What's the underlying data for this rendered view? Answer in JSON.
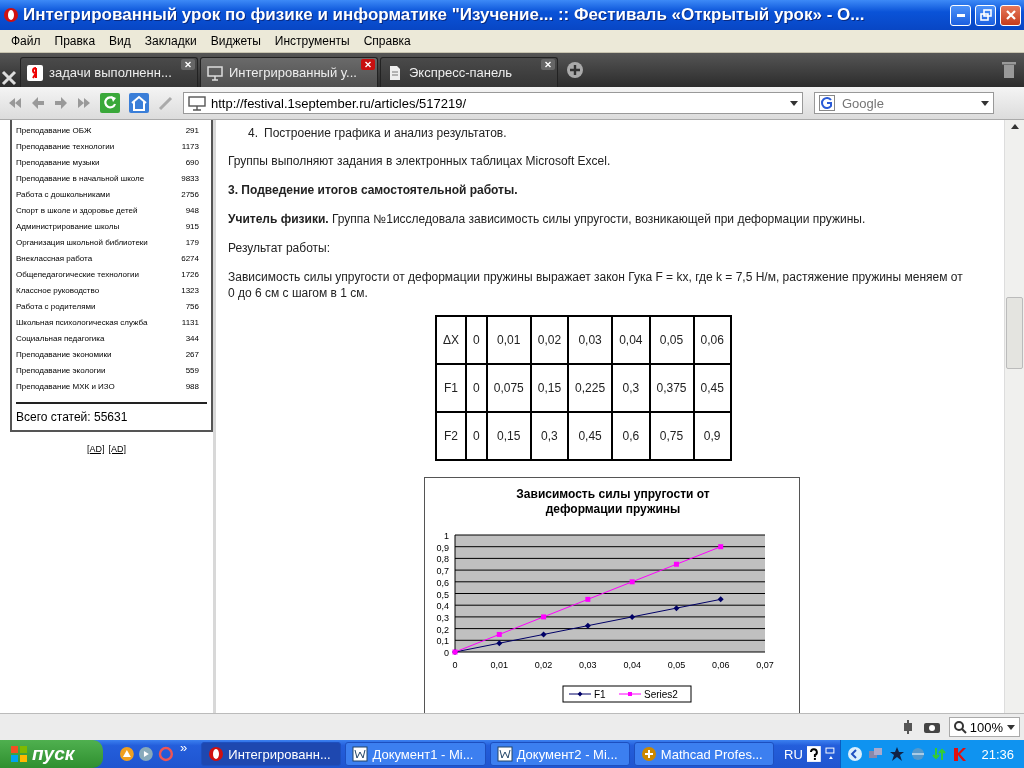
{
  "window": {
    "title": "Интегрированный урок по физике и информатике \"Изучение... :: Фестиваль «Открытый урок» - О..."
  },
  "menu": [
    "Файл",
    "Правка",
    "Вид",
    "Закладки",
    "Виджеты",
    "Инструменты",
    "Справка"
  ],
  "tabs": [
    {
      "label": "задачи выполненн...",
      "selected": false,
      "kind": "search"
    },
    {
      "label": "Интегрированный у...",
      "selected": true,
      "kind": "page"
    },
    {
      "label": "Экспресс-панель",
      "selected": false,
      "kind": "doc"
    }
  ],
  "address": {
    "value": "http://festival.1september.ru/articles/517219/"
  },
  "search": {
    "placeholder": "Google"
  },
  "sidebar": {
    "items": [
      {
        "name": "Преподавание ОБЖ",
        "count": "291"
      },
      {
        "name": "Преподавание технологии",
        "count": "1173"
      },
      {
        "name": "Преподавание музыки",
        "count": "690"
      },
      {
        "name": "Преподавание в начальной школе",
        "count": "9833"
      },
      {
        "name": "Работа с дошкольниками",
        "count": "2756"
      },
      {
        "name": "Спорт в школе и здоровье детей",
        "count": "948"
      },
      {
        "name": "Администрирование школы",
        "count": "915"
      },
      {
        "name": "Организация школьной библиотеки",
        "count": "179"
      },
      {
        "name": "Внеклассная работа",
        "count": "6274"
      },
      {
        "name": "Общепедагогические технологии",
        "count": "1726"
      },
      {
        "name": "Классное руководство",
        "count": "1323"
      },
      {
        "name": "Работа с родителями",
        "count": "756"
      },
      {
        "name": "Школьная психологическая служба",
        "count": "1131"
      },
      {
        "name": "Социальная педагогика",
        "count": "344"
      },
      {
        "name": "Преподавание экономики",
        "count": "267"
      },
      {
        "name": "Преподавание экологии",
        "count": "559"
      },
      {
        "name": "Преподавание МХК и ИЗО",
        "count": "988"
      }
    ],
    "total": "Всего статей: 55631",
    "ads": [
      "[AD]",
      "[AD]"
    ]
  },
  "article": {
    "list_item": {
      "number": "4.",
      "text": "Построение графика и анализ результатов."
    },
    "paragraphs": [
      "Группы выполняют задания в электронных таблицах Microsoft Excel.",
      "**3. Подведение итогов самостоятельной работы.**",
      "**Учитель физики.** Группа №1исследовала зависимость силы упругости, возникающей при деформации пружины.",
      "Результат работы:",
      "Зависимость силы упругости от деформации пружины выражает закон Гука F = kx, где k = 7,5 Н/м, растяжение пружины меняем от 0 до 6 см с шагом в 1 см."
    ],
    "table": [
      [
        "ΔX",
        "0",
        "0,01",
        "0,02",
        "0,03",
        "0,04",
        "0,05",
        "0,06"
      ],
      [
        "F1",
        "0",
        "0,075",
        "0,15",
        "0,225",
        "0,3",
        "0,375",
        "0,45"
      ],
      [
        "F2",
        "0",
        "0,15",
        "0,3",
        "0,45",
        "0,6",
        "0,75",
        "0,9"
      ]
    ],
    "chart_data": {
      "type": "line",
      "title": "Зависимость силы упругости от деформации пружины",
      "x": [
        0,
        0.01,
        0.02,
        0.03,
        0.04,
        0.05,
        0.06
      ],
      "series": [
        {
          "name": "F1",
          "color": "#000066",
          "marker": "diamond",
          "values": [
            0,
            0.075,
            0.15,
            0.225,
            0.3,
            0.375,
            0.45
          ]
        },
        {
          "name": "Series2",
          "color": "#ff00ff",
          "marker": "square",
          "values": [
            0,
            0.15,
            0.3,
            0.45,
            0.6,
            0.75,
            0.9
          ]
        }
      ],
      "grid": true,
      "legend": "bottom",
      "xlim": [
        0,
        0.07
      ],
      "ylim": [
        0,
        1
      ],
      "xticks": [
        {
          "value": 0,
          "label": "0"
        },
        {
          "value": 0.01,
          "label": "0,01"
        },
        {
          "value": 0.02,
          "label": "0,02"
        },
        {
          "value": 0.03,
          "label": "0,03"
        },
        {
          "value": 0.04,
          "label": "0,04"
        },
        {
          "value": 0.05,
          "label": "0,05"
        },
        {
          "value": 0.06,
          "label": "0,06"
        },
        {
          "value": 0.07,
          "label": "0,07"
        }
      ],
      "yticks": [
        {
          "value": 0,
          "label": "0"
        },
        {
          "value": 0.1,
          "label": "0,1"
        },
        {
          "value": 0.2,
          "label": "0,2"
        },
        {
          "value": 0.3,
          "label": "0,3"
        },
        {
          "value": 0.4,
          "label": "0,4"
        },
        {
          "value": 0.5,
          "label": "0,5"
        },
        {
          "value": 0.6,
          "label": "0,6"
        },
        {
          "value": 0.7,
          "label": "0,7"
        },
        {
          "value": 0.8,
          "label": "0,8"
        },
        {
          "value": 0.9,
          "label": "0,9"
        },
        {
          "value": 1,
          "label": "1"
        }
      ]
    }
  },
  "status_bar": {
    "zoom": "100%"
  },
  "taskbar": {
    "start": "пуск",
    "tasks": [
      {
        "label": "Интегрированн...",
        "selected": true,
        "kind": "browser"
      },
      {
        "label": "Документ1 - Mi...",
        "selected": false,
        "kind": "word"
      },
      {
        "label": "Документ2 - Mi...",
        "selected": false,
        "kind": "word"
      },
      {
        "label": "Mathcad Profes...",
        "selected": false,
        "kind": "mathcad"
      }
    ],
    "more": "»",
    "language": "RU",
    "clock": "21:36"
  }
}
